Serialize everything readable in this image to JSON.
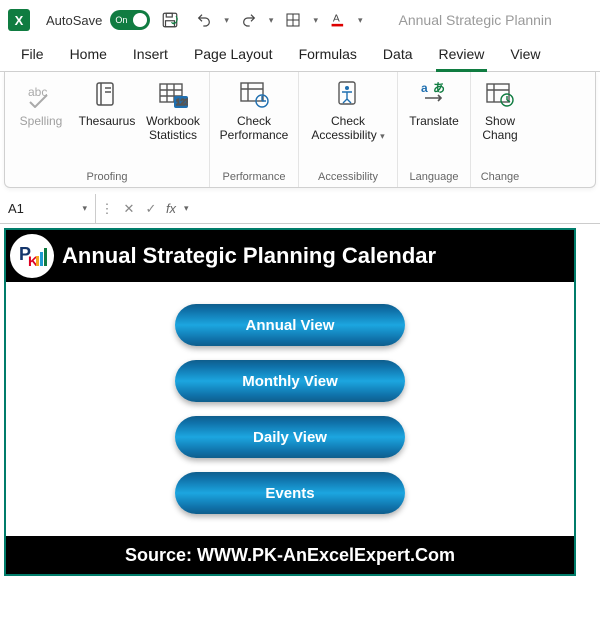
{
  "titlebar": {
    "autosave_label": "AutoSave",
    "toggle_text": "On",
    "doc_title": "Annual Strategic Plannin"
  },
  "tabs": {
    "file": "File",
    "home": "Home",
    "insert": "Insert",
    "pagelayout": "Page Layout",
    "formulas": "Formulas",
    "data": "Data",
    "review": "Review",
    "view": "View"
  },
  "ribbon": {
    "proofing": {
      "group_name": "Proofing",
      "spelling": "Spelling",
      "thesaurus": "Thesaurus",
      "workbook_stats": "Workbook\nStatistics"
    },
    "performance": {
      "group_name": "Performance",
      "check_perf": "Check\nPerformance"
    },
    "accessibility": {
      "group_name": "Accessibility",
      "check_access": "Check\nAccessibility"
    },
    "language": {
      "group_name": "Language",
      "translate": "Translate"
    },
    "changes": {
      "group_name": "Change",
      "show_changes": "Show\nChang"
    }
  },
  "formula_bar": {
    "cell_ref": "A1",
    "fx": "fx"
  },
  "sheet": {
    "title": "Annual Strategic Planning Calendar",
    "buttons": {
      "annual": "Annual View",
      "monthly": "Monthly View",
      "daily": "Daily View",
      "events": "Events"
    },
    "footer": "Source: WWW.PK-AnExcelExpert.Com"
  }
}
